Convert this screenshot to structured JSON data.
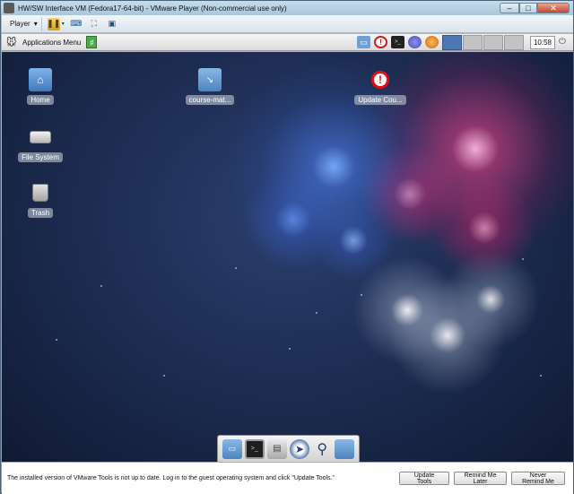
{
  "window": {
    "title": "HW/SW Interface VM (Fedora17-64-bit) - VMware Player (Non-commercial use only)",
    "minimize_label": "–",
    "maximize_label": "□",
    "close_label": "✕"
  },
  "vm_toolbar": {
    "player_label": "Player",
    "player_arrow": "▾",
    "pause_arrow": "▾"
  },
  "guest_panel": {
    "applications_label": "Applications Menu",
    "clock": "10:58",
    "workspaces": [
      {
        "active": true
      },
      {
        "active": false
      },
      {
        "active": false
      },
      {
        "active": false
      }
    ]
  },
  "desktop": {
    "icons": {
      "home": {
        "label": "Home",
        "icon": "home-folder-icon"
      },
      "file_system": {
        "label": "File System",
        "icon": "drive-icon"
      },
      "trash": {
        "label": "Trash",
        "icon": "trash-icon"
      },
      "course": {
        "label": "course-mat...",
        "icon": "folder-link-icon"
      },
      "update": {
        "label": "Update Cou...",
        "icon": "warning-icon"
      }
    }
  },
  "dock": {
    "items": [
      "show-desktop-icon",
      "terminal-icon",
      "file-manager-icon",
      "web-browser-icon",
      "search-icon",
      "folder-icon"
    ]
  },
  "notice": {
    "text": "The installed version of VMware Tools is not up to date. Log in to the guest operating system and click \"Update Tools.\"",
    "update_tools": "Update Tools",
    "remind_later": "Remind Me Later",
    "never_remind": "Never Remind Me"
  }
}
